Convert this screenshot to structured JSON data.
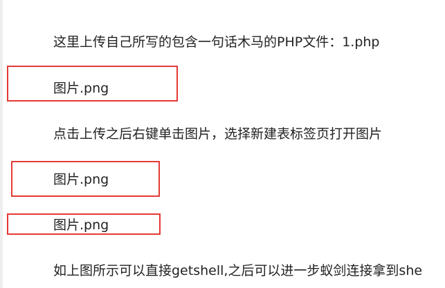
{
  "article": {
    "paragraphs": [
      "这里上传自己所写的包含一句话木马的PHP文件：1.php",
      "图片.png",
      "点击上传之后右键单击图片，选择新建表标签页打开图片",
      "图片.png",
      "图片.png",
      "如上图所示可以直接getshell,之后可以进一步蚁剑连接拿到she"
    ]
  },
  "colors": {
    "highlight_border": "#e53935",
    "text": "#222222"
  }
}
